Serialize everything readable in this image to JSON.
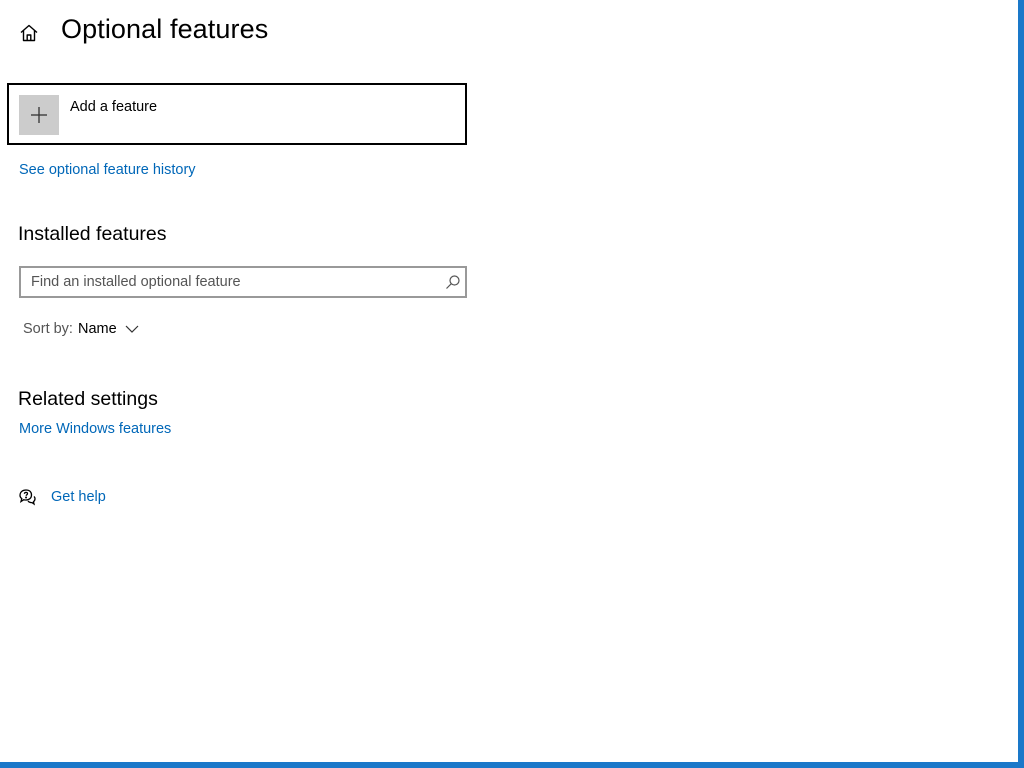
{
  "header": {
    "title": "Optional features",
    "home_icon": "home-icon"
  },
  "add_feature": {
    "label": "Add a feature",
    "icon": "plus-icon"
  },
  "history_link": {
    "label": "See optional feature history"
  },
  "installed": {
    "heading": "Installed features",
    "search_placeholder": "Find an installed optional feature",
    "search_value": "",
    "search_icon": "search-icon",
    "sort_label": "Sort by:",
    "sort_value": "Name",
    "sort_icon": "chevron-down-icon"
  },
  "related": {
    "heading": "Related settings",
    "link": "More Windows features"
  },
  "help": {
    "label": "Get help",
    "icon": "help-chat-icon"
  },
  "colors": {
    "accent": "#0067b8",
    "window_border": "#1a78c9",
    "tile_background": "#cccccc"
  }
}
